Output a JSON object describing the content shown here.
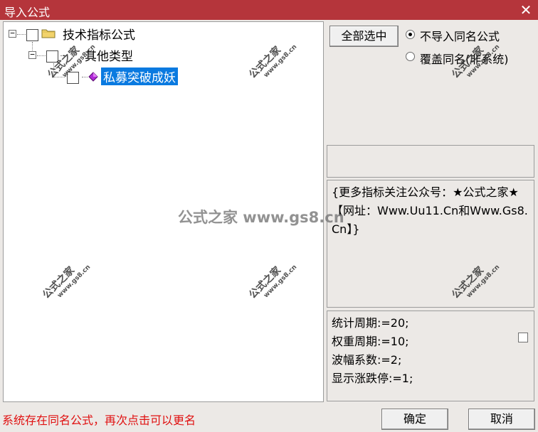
{
  "window": {
    "title": "导入公式",
    "close_glyph": "✕"
  },
  "tree": {
    "root": {
      "label": "技术指标公式",
      "expander": "−"
    },
    "child": {
      "label": "其他类型",
      "expander": "−"
    },
    "leaf": {
      "label": "私募突破成妖"
    }
  },
  "options": {
    "select_all_label": "全部选中",
    "radio_no_import": "不导入同名公式",
    "radio_overwrite": "覆盖同名(非系统)",
    "selected": "no_import"
  },
  "description": "{更多指标关注公众号：★公式之家★ 【网址：Www.Uu11.Cn和Www.Gs8.Cn】}",
  "params": [
    "统计周期:=20;",
    "权重周期:=10;",
    "波幅系数:=2;",
    "显示涨跌停:=1;"
  ],
  "status_message": "系统存在同名公式，再次点击可以更名",
  "buttons": {
    "ok": "确定",
    "cancel": "取消"
  },
  "watermark": {
    "brand": "公式之家",
    "url": "www.gs8.cn",
    "center": "公式之家 www.gs8.cn"
  },
  "colors": {
    "titlebar": "#b5353b",
    "selection": "#0a7ae0",
    "status": "#e01010"
  }
}
